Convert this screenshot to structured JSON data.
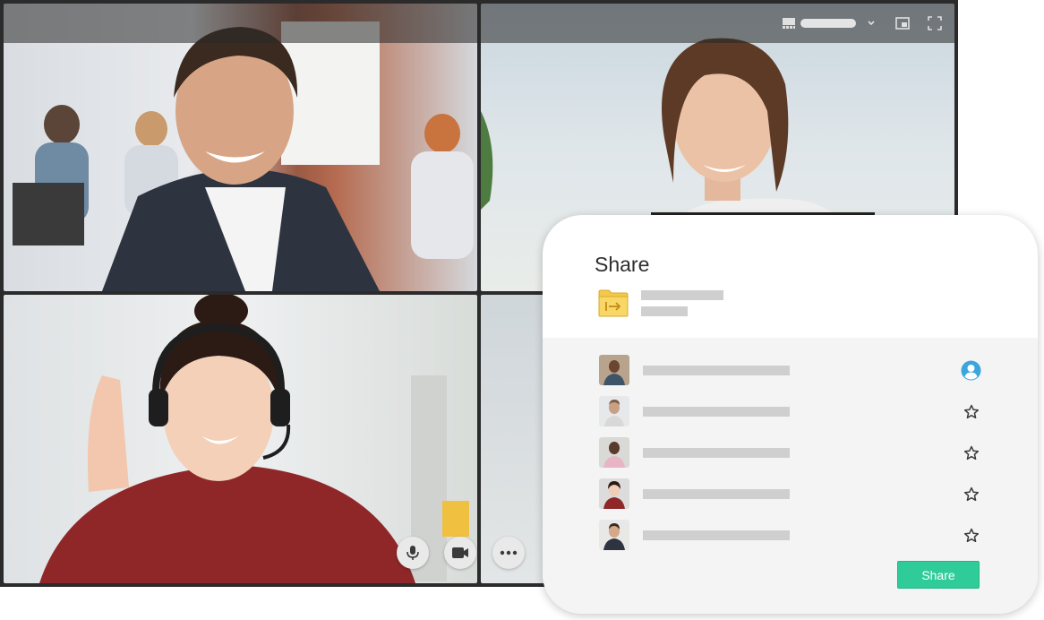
{
  "video_call": {
    "participants": [
      {
        "id": "participant-1",
        "description": "man-in-suit"
      },
      {
        "id": "participant-2",
        "description": "woman-striped-shirt"
      },
      {
        "id": "participant-3",
        "description": "woman-headset-waving"
      },
      {
        "id": "participant-4",
        "description": "partially-hidden"
      }
    ],
    "top_controls": [
      "layout-icon",
      "chevron-down-icon",
      "picture-in-picture-icon",
      "fullscreen-icon"
    ],
    "call_controls": [
      "microphone-icon",
      "camera-icon",
      "more-icon"
    ]
  },
  "share_dialog": {
    "title": "Share",
    "folder_icon": "shared-folder-icon",
    "people": [
      {
        "role_icon": "user-icon"
      },
      {
        "role_icon": "star-icon"
      },
      {
        "role_icon": "star-icon"
      },
      {
        "role_icon": "star-icon"
      },
      {
        "role_icon": "star-icon"
      }
    ],
    "share_button_label": "Share"
  },
  "colors": {
    "accent": "#2fcc9a",
    "user_icon": "#3aa6dd",
    "folder": "#f3c94b"
  }
}
